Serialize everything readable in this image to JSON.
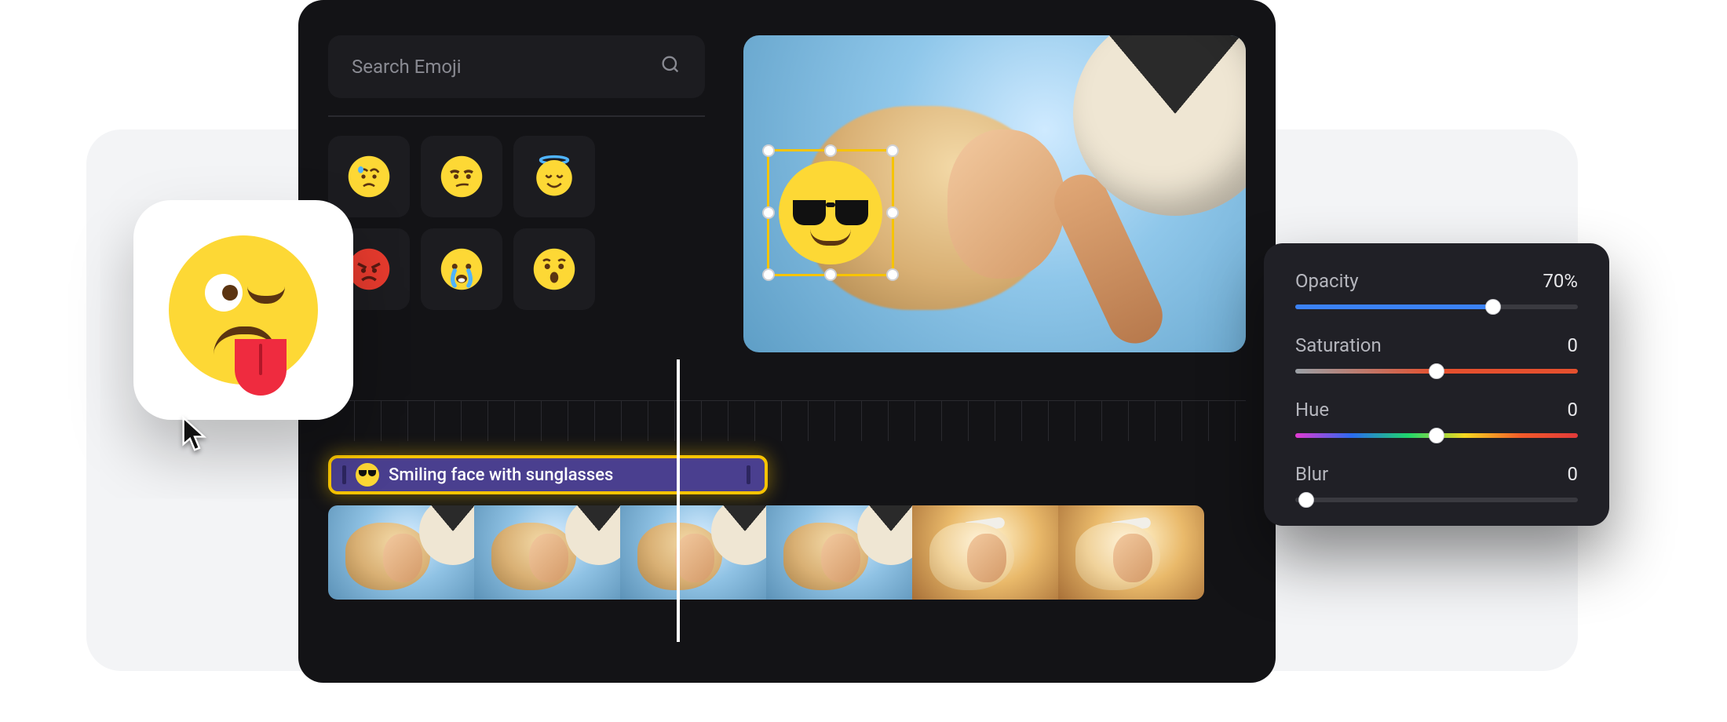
{
  "search": {
    "placeholder": "Search Emoji"
  },
  "emoji_grid": [
    {
      "name": "disappointed-relieved",
      "icon": "relieved"
    },
    {
      "name": "unamused-face",
      "icon": "unamused"
    },
    {
      "name": "smiling-face-halo",
      "icon": "halo"
    },
    {
      "name": "pouting-face",
      "icon": "angry"
    },
    {
      "name": "crying-face",
      "icon": "cry"
    },
    {
      "name": "hushed-face",
      "icon": "hushed"
    }
  ],
  "preview": {
    "selected_emoji": {
      "name": "smiling-face-with-sunglasses"
    }
  },
  "timeline": {
    "clip_label": "Smiling face with sunglasses",
    "clip_icon": "sunglasses",
    "frame_count": 6
  },
  "properties": {
    "opacity": {
      "label": "Opacity",
      "value_text": "70%",
      "pct": 70
    },
    "saturation": {
      "label": "Saturation",
      "value_text": "0",
      "pct": 50
    },
    "hue": {
      "label": "Hue",
      "value_text": "0",
      "pct": 50
    },
    "blur": {
      "label": "Blur",
      "value_text": "0",
      "pct": 4
    }
  },
  "picked_card": {
    "emoji_name": "winking-face-with-tongue"
  },
  "colors": {
    "accent": "#f7c400",
    "clip": "#4a3f8f",
    "blue": "#3b82f6"
  }
}
